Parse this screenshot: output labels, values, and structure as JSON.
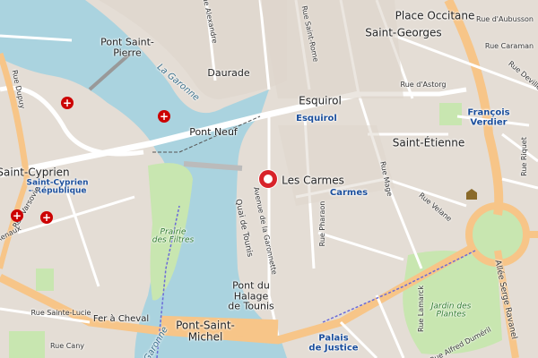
{
  "map": {
    "places": {
      "place_occitane": "Place Occitane",
      "saint_georges": "Saint-Georges",
      "pont_saint_pierre": "Pont Saint-\nPierre",
      "daurade": "Daurade",
      "saint_cyprien": "Saint-Cyprien",
      "pont_neuf": "Pont Neuf",
      "esquirol": "Esquirol",
      "saint_etienne": "Saint-Étienne",
      "les_carmes": "Les Carmes",
      "pont_halage": "Pont du\nHalage\nde Tounis",
      "pont_saint_michel": "Pont-Saint-\nMichel"
    },
    "metro": {
      "esquirol": "Esquirol",
      "saint_cyprien_republique": "Saint-Cyprien\n– République",
      "carmes": "Carmes",
      "francois_verdier": "François\nVerdier",
      "palais_de_justice": "Palais\nde Justice"
    },
    "streets": {
      "rue_aubusson": "Rue d'Aubusson",
      "rue_caraman": "Rue Caraman",
      "rue_astorg": "Rue d'Astorg",
      "rue_rome": "Rue Saint-Rome",
      "rue_alexandre": "Rue Alexandre",
      "quai_tounis": "Quai de Tounis",
      "avenue_garonnette": "Avenue de la Garonnette",
      "rue_pharaon": "Rue Pharaon",
      "rue_mage": "Rue Mage",
      "rue_velane": "Rue Velane",
      "rue_riquet": "Rue Riquet",
      "rue_sainte_lucie": "Rue Sainte-Lucie",
      "fer_a_cheval": "Fer à Cheval",
      "rue_cany": "Rue Cany",
      "rue_lamarck": "Rue Lamarck",
      "rue_alfred_dumeril": "Rue Alfred Duméril",
      "allee_serge_ravanel": "Allée Serge Ravanel",
      "rue_varsovie": "Rue Varsovie",
      "renaux": "Renaux",
      "rue_deville": "Rue Deville",
      "rue_dupuy": "Rue Dupuy"
    },
    "parks": {
      "prairie_filtres": "Prairie\ndes Filtres",
      "jardin_plantes": "Jardin des\nPlantes"
    },
    "river": {
      "la_garonne": "La Garonne",
      "garonne": "Garonne"
    },
    "colors": {
      "water": "#aad3df",
      "land": "#e6dfd8",
      "road_major": "#f7c588",
      "road_minor": "#ffffff",
      "park": "#c8e6b0",
      "metro": "#1a4e9c",
      "marker": "#d8232a",
      "hospital": "#c00000"
    },
    "icons": [
      "hospital-icon",
      "map-marker-icon",
      "museum-icon",
      "metro-icon"
    ]
  }
}
